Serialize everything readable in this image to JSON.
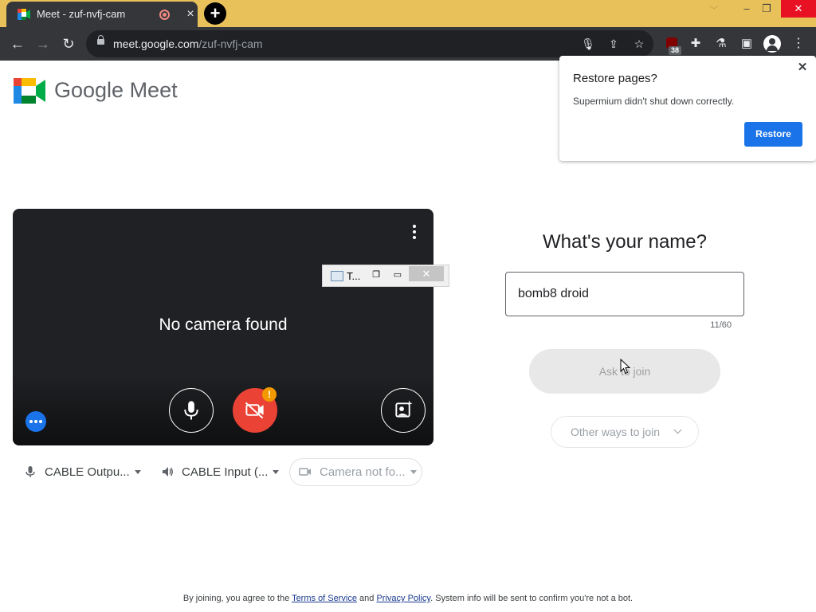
{
  "browser": {
    "tab_title": "Meet - zuf-nvfj-cam",
    "tab_close": "×",
    "new_tab": "+",
    "url_host": "meet.google.com",
    "url_path": "/zuf-nvfj-cam",
    "extension_badge": "38",
    "window_controls": {
      "minimize": "–",
      "restore": "❐",
      "close": "✕"
    }
  },
  "page": {
    "brand": "Google Meet",
    "preview": {
      "message": "No camera found",
      "warning_badge": "!"
    },
    "devices": {
      "mic": "CABLE Outpu...",
      "speaker": "CABLE Input (...",
      "camera": "Camera not fo..."
    },
    "join": {
      "title": "What's your name?",
      "name_value": "bomb8 droid",
      "char_count": "11/60",
      "ask_button": "Ask to join",
      "other_button": "Other ways to join"
    },
    "footer": {
      "prefix": "By joining, you agree to the ",
      "terms": "Terms of Service",
      "and": " and ",
      "privacy": "Privacy Policy",
      "suffix": ". System info will be sent to confirm you're not a bot."
    }
  },
  "floating_window": {
    "title": "T..."
  },
  "restore_popup": {
    "title": "Restore pages?",
    "message": "Supermium didn't shut down correctly.",
    "button": "Restore",
    "close": "✕"
  },
  "colors": {
    "accent": "#1a73e8",
    "danger": "#ea4335",
    "warning": "#f29900",
    "titlebar": "#e8c15a"
  }
}
